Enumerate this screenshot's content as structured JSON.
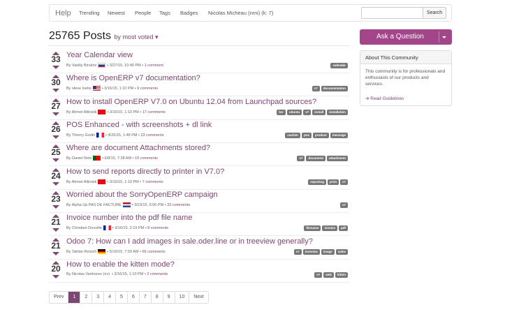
{
  "nav": {
    "brand": "Help",
    "links": [
      "Trending",
      "Newest",
      "People",
      "Tags",
      "Badges",
      "Nicolas Micheau (nmi) (k: 7)"
    ],
    "search_placeholder": "",
    "search_button": "Search"
  },
  "header": {
    "count_title": "25765 Posts",
    "sort_prefix": "by",
    "sort_value": "most voted"
  },
  "posts": [
    {
      "votes": "33",
      "title": "Year Calendar view",
      "author": "By Vasiliy Birukov",
      "flag": "ru",
      "date": "• 3/27/15, 10:40 PM •",
      "comments": "1 comment",
      "tags": [
        "calendar"
      ]
    },
    {
      "votes": "30",
      "title": "Where is OpenERP v7 documentation?",
      "author": "By steve loebs",
      "flag": "us",
      "date": "• 3/16/15, 1:10 PM •",
      "comments": "9 comments",
      "tags": [
        "v7",
        "documentation"
      ]
    },
    {
      "votes": "27",
      "title": "How to install OpenERP V7.0 on Ubuntu 12.04 from Launchpad sources?",
      "author": "By Ahmet Altinisik",
      "flag": "tr",
      "date": "• 3/16/15, 1:10 PM •",
      "comments": "17 comments",
      "tags": [
        "bzr",
        "ubuntu",
        "v7",
        "install",
        "installation"
      ]
    },
    {
      "votes": "26",
      "title": "POS Enhanced - with screenshots + dl link",
      "author": "By Thierry Godin",
      "flag": "fr",
      "date": "• 4/26/15, 1:48 PM •",
      "comments": "23 comments",
      "tags": [
        "cashier",
        "pos",
        "product",
        "message"
      ]
    },
    {
      "votes": "25",
      "title": "Where are document Attachments stored?",
      "author": "By Daniel Reis",
      "flag": "pt",
      "date": "• 6/8/15, 7:28 AM •",
      "comments": "10 comments",
      "tags": [
        "v7",
        "document",
        "attachment"
      ]
    },
    {
      "votes": "24",
      "title": "How to send reports directly to printer in V7.0?",
      "author": "By Ahmet Altinisik",
      "flag": "tr",
      "date": "• 3/16/15, 1:10 PM •",
      "comments": "7 comments",
      "tags": [
        "reporting",
        "print",
        "v7"
      ]
    },
    {
      "votes": "23",
      "title": "Worried about the SorryOpenERP campaign",
      "author": "By Alpha Up PAS DE FACTURE",
      "flag": "nl",
      "date": "• 3/23/15, 6:00 PM •",
      "comments": "33 comments",
      "tags": [
        "v7"
      ]
    },
    {
      "votes": "21",
      "title": "Invoice number into the pdf file name",
      "author": "By Christian Douville",
      "flag": "fr",
      "date": "• 3/16/15, 2:19 PM •",
      "comments": "8 comments",
      "tags": [
        "filename",
        "invoice",
        "pdf"
      ]
    },
    {
      "votes": "21",
      "title": "Odoo 7: How can I add images in sale.oder.line or in treeview generally?",
      "author": "By Stefan Reisich",
      "flag": "de",
      "date": "• 5/19/15, 7:59 AM •",
      "comments": "66 comments",
      "tags": [
        "v7",
        "treeview",
        "image",
        "sales"
      ]
    },
    {
      "votes": "20",
      "title": "How to enable the kitten mode?",
      "author": "By Nicolas Vanhoren (nv)",
      "flag": "",
      "date": "• 3/16/15, 1:10 PM •",
      "comments": "2 comments",
      "tags": [
        "v7",
        "web",
        "kitten"
      ]
    }
  ],
  "pagination": [
    "Prev",
    "1",
    "2",
    "3",
    "4",
    "5",
    "6",
    "7",
    "8",
    "9",
    "10",
    "Next"
  ],
  "pagination_active": "1",
  "sidebar": {
    "ask_button": "Ask a Question",
    "about_title": "About This Community",
    "about_text": "This community is for professionals and enthusiasts of our products and services.",
    "guidelines_link": "➔ Read Guidelines"
  },
  "colors": {
    "accent": "#7c4770",
    "button": "#a24689",
    "tag": "#777777"
  }
}
